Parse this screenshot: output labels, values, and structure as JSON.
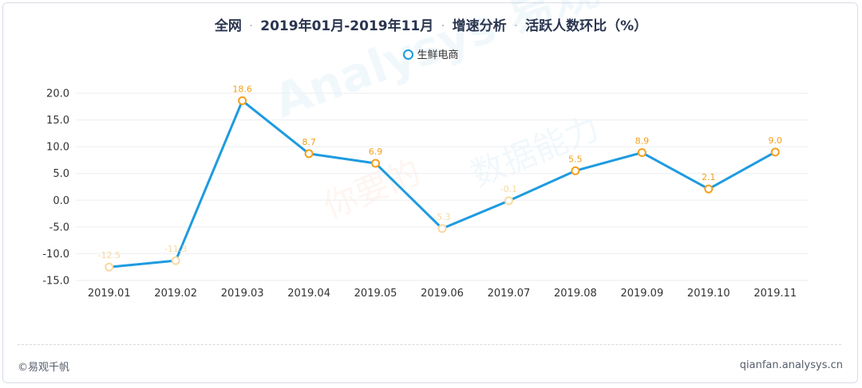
{
  "title_parts": {
    "scope": "全网",
    "period": "2019年01月-2019年11月",
    "analysis": "增速分析",
    "metric": "活跃人数环比（%）"
  },
  "title_separator": "·",
  "legend": {
    "label": "生鲜电商",
    "color": "#1e9be0"
  },
  "watermark": {
    "text": "Analysys 易观",
    "slogan_a": "你要的",
    "slogan_b": "数据能力"
  },
  "footer": {
    "left": "©易观千帆",
    "right": "qianfan.analysys.cn"
  },
  "chart_data": {
    "type": "line",
    "categories": [
      "2019.01",
      "2019.02",
      "2019.03",
      "2019.04",
      "2019.05",
      "2019.06",
      "2019.07",
      "2019.08",
      "2019.09",
      "2019.10",
      "2019.11"
    ],
    "series": [
      {
        "name": "生鲜电商",
        "values": [
          -12.5,
          -11.3,
          18.6,
          8.7,
          6.9,
          -5.3,
          -0.1,
          5.5,
          8.9,
          2.1,
          9.0
        ],
        "labels": [
          "-12.5",
          "-11.3",
          "18.6",
          "8.7",
          "6.9",
          "-5.3",
          "-0.1",
          "5.5",
          "8.9",
          "2.1",
          "9.0"
        ]
      }
    ],
    "ylim": [
      -15,
      20
    ],
    "yticks": [
      "20.0",
      "15.0",
      "10.0",
      "5.0",
      "0.0",
      "-5.0",
      "-10.0",
      "-15.0"
    ],
    "ytick_values": [
      20,
      15,
      10,
      5,
      0,
      -5,
      -10,
      -15
    ],
    "line_color": "#1e9be0",
    "positive_marker_color": "#f3a01c",
    "negative_marker_color": "#f6d9a2",
    "grid": true,
    "legend_position": "top-center"
  }
}
